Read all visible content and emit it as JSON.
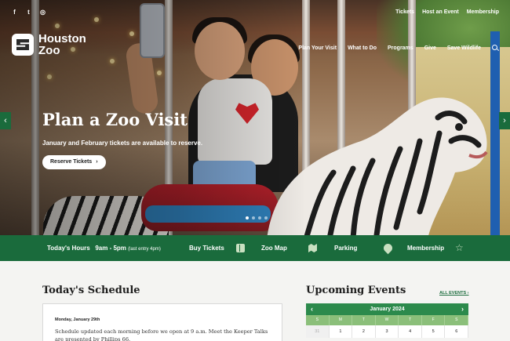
{
  "social": {
    "icons": [
      "facebook-icon",
      "twitter-icon",
      "instagram-icon"
    ],
    "glyphs": [
      "f",
      "t",
      "◎"
    ]
  },
  "utility_nav": [
    "Tickets",
    "Host an Event",
    "Membership"
  ],
  "logo": {
    "line1": "Houston",
    "line2": "Zoo"
  },
  "main_nav": [
    "Plan Your Visit",
    "What to Do",
    "Programs",
    "Give",
    "Save Wildlife"
  ],
  "hero": {
    "title": "Plan a Zoo Visit",
    "subtitle": "January and February tickets are available to reserve.",
    "cta_label": "Reserve Tickets",
    "cta_arrow": "›",
    "arrow_left": "‹",
    "arrow_right": "›",
    "slide_count": 4,
    "active_slide": 1
  },
  "info_bar": {
    "hours_label": "Today's Hours",
    "hours_value": "9am - 5pm",
    "hours_note": "(last entry 4pm)",
    "buy_tickets": "Buy Tickets",
    "zoo_map": "Zoo Map",
    "parking": "Parking",
    "membership": "Membership",
    "star_glyph": "☆"
  },
  "schedule": {
    "title": "Today's Schedule",
    "date": "Monday, January 29th",
    "text": "Schedule updated each morning before we open at 9 a.m. Meet the Keeper Talks are presented by Phillips 66."
  },
  "events": {
    "title": "Upcoming Events",
    "all_events": "ALL EVENTS ›",
    "month": "January 2024",
    "prev": "‹",
    "next": "›",
    "weekdays": [
      "S",
      "M",
      "T",
      "W",
      "T",
      "F",
      "S"
    ],
    "first_week": [
      "31",
      "1",
      "2",
      "3",
      "4",
      "5",
      "6"
    ]
  },
  "colors": {
    "brand_green": "#1a6b3c",
    "calendar_header": "#2c8a4c",
    "calendar_dow": "#8bbf7a",
    "accent_red": "#d4242b"
  }
}
